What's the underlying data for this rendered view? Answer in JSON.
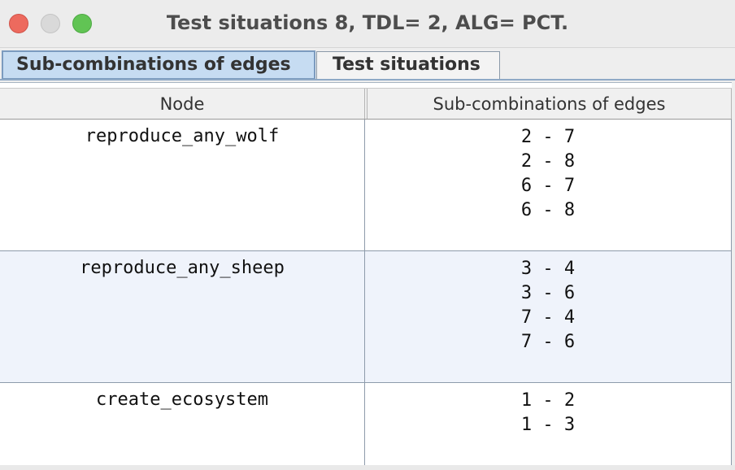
{
  "window": {
    "title": "Test situations 8, TDL= 2, ALG= PCT."
  },
  "tabs": [
    {
      "label": "Sub-combinations of edges",
      "active": true
    },
    {
      "label": "Test situations",
      "active": false
    }
  ],
  "table": {
    "columns": [
      "Node",
      "Sub-combinations of edges"
    ],
    "rows": [
      {
        "node": "reproduce_any_wolf",
        "edges": [
          "2 - 7",
          "2 - 8",
          "6 - 7",
          "6 - 8"
        ]
      },
      {
        "node": "reproduce_any_sheep",
        "edges": [
          "3 - 4",
          "3 - 6",
          "7 - 4",
          "7 - 6"
        ]
      },
      {
        "node": "create_ecosystem",
        "edges": [
          "1 - 2",
          "1 - 3"
        ]
      }
    ]
  },
  "colors": {
    "close": "#ed6a5e",
    "minimize": "#d9d9d9",
    "zoom": "#61c454",
    "active_tab": "#c6dcf2",
    "alt_row": "#eff3fb"
  }
}
